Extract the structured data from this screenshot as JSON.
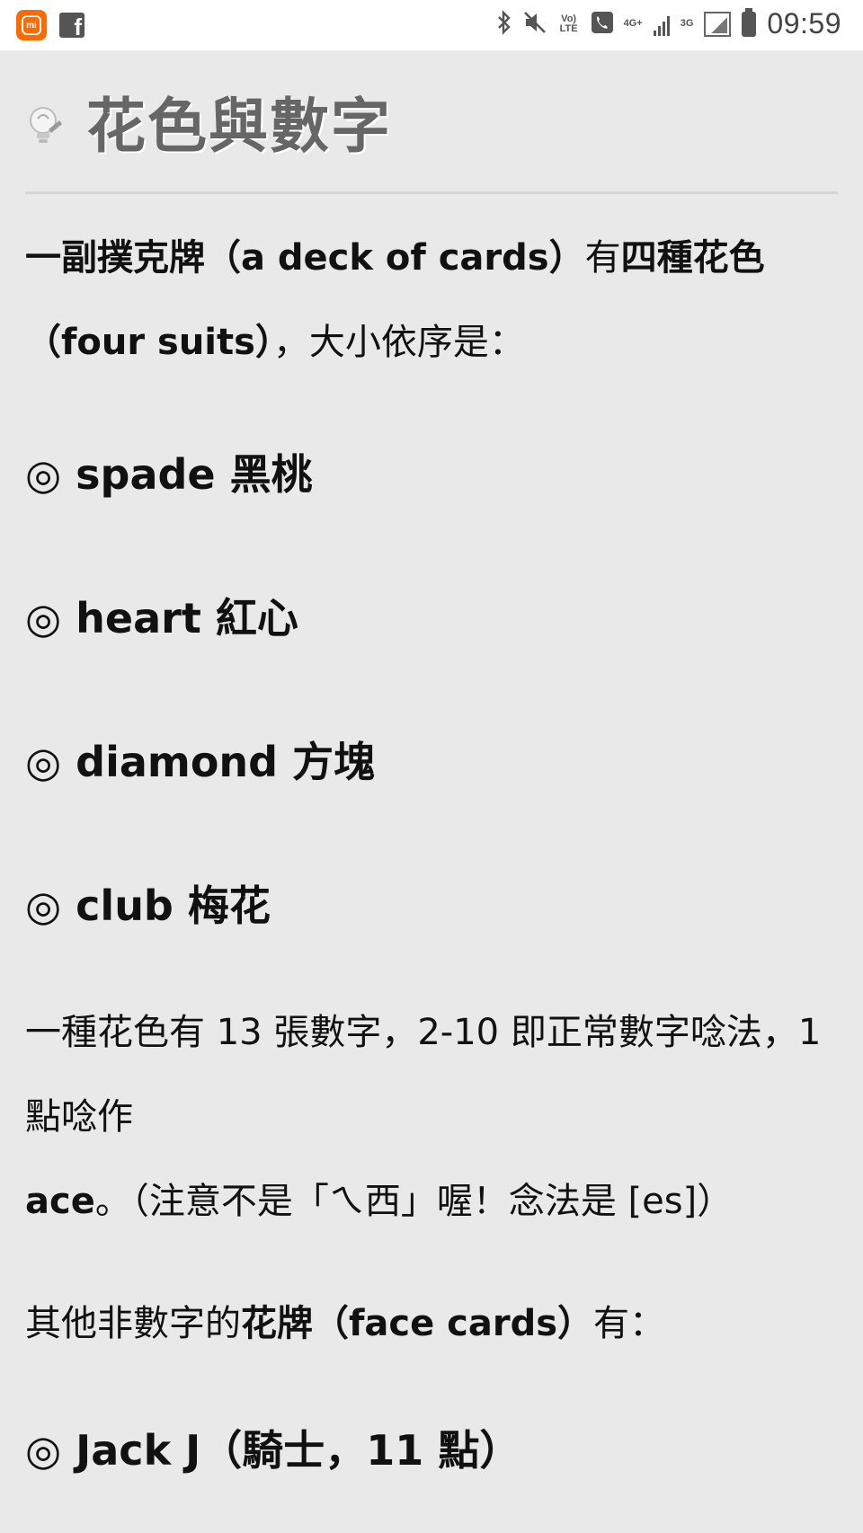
{
  "status_bar": {
    "time": "09:59",
    "volte_label": "Vo) LTE",
    "net1_label": "4G+",
    "net2_label": "3G",
    "mi_label": "mi",
    "fb_label": "f",
    "icons": [
      "mi-app-icon",
      "facebook-icon",
      "bluetooth-icon",
      "mute-icon",
      "volte-icon",
      "phone-icon",
      "signal-icon",
      "battery-icon"
    ]
  },
  "article": {
    "title": "花色與數字",
    "intro": {
      "b1": "一副撲克牌（a deck of cards）",
      "t1": "有",
      "b2": "四種花色",
      "b3": "（four suits）",
      "t2": "，大小依序是："
    },
    "suits": [
      "◎ spade 黑桃",
      "◎ heart 紅心",
      "◎ diamond 方塊",
      "◎ club 梅花"
    ],
    "numbers": {
      "t1": "一種花色有 13 張數字，2-10 即正常數字唸法，1 點唸作 ",
      "b1": "ace",
      "t2": "。（注意不是「ㄟ西」喔！念法是 [es]）"
    },
    "face": {
      "t1": "其他非數字的",
      "b1": "花牌（face cards）",
      "t2": "有："
    },
    "jack": "◎ Jack J（騎士，11 點）"
  }
}
